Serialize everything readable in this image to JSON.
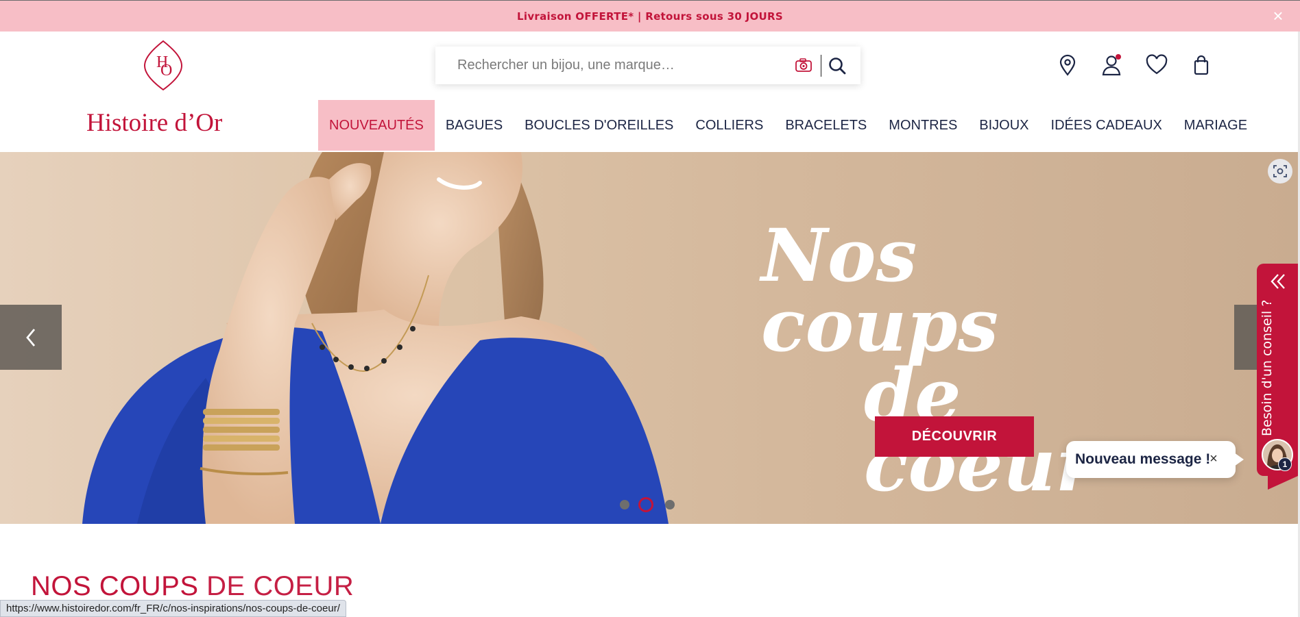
{
  "announcement": {
    "text": "Livraison OFFERTE* | Retours sous 30 JOURS",
    "close_icon": "×"
  },
  "brand": {
    "name": "Histoire d’Or",
    "monogram": "HO",
    "color": "#c2143a"
  },
  "search": {
    "placeholder": "Rechercher un bijou, une marque…",
    "camera_icon": "camera-icon",
    "submit_icon": "search-icon"
  },
  "header_icons": [
    "store-locator-icon",
    "account-icon",
    "wishlist-heart-icon",
    "cart-bag-icon"
  ],
  "nav": {
    "items": [
      {
        "label": "NOUVEAUTÉS",
        "active": true
      },
      {
        "label": "BAGUES"
      },
      {
        "label": "BOUCLES D'OREILLES"
      },
      {
        "label": "COLLIERS"
      },
      {
        "label": "BRACELETS"
      },
      {
        "label": "MONTRES"
      },
      {
        "label": "BIJOUX"
      },
      {
        "label": "IDÉES CADEAUX"
      },
      {
        "label": "MARIAGE"
      }
    ]
  },
  "hero": {
    "title_line1": "Nos coups",
    "title_line2": "de coeur",
    "cta_label": "DÉCOUVRIR",
    "slides_count": 3,
    "active_slide": 2
  },
  "conseil": {
    "label": "Besoin d'un conseil ?",
    "chevron_icon": "double-chevron-left-icon",
    "unread_count": "1"
  },
  "chat_bubble": {
    "text": "Nouveau message !",
    "close_icon": "×"
  },
  "section": {
    "title_part1": "NOS COUPS",
    "title_part2": "DE COEUR"
  },
  "status_bar": {
    "url": "https://www.histoiredor.com/fr_FR/c/nos-inspirations/nos-coups-de-coeur/"
  },
  "colors": {
    "accent": "#c2143a",
    "pink": "#f7bec6",
    "navy": "#1c2544"
  }
}
